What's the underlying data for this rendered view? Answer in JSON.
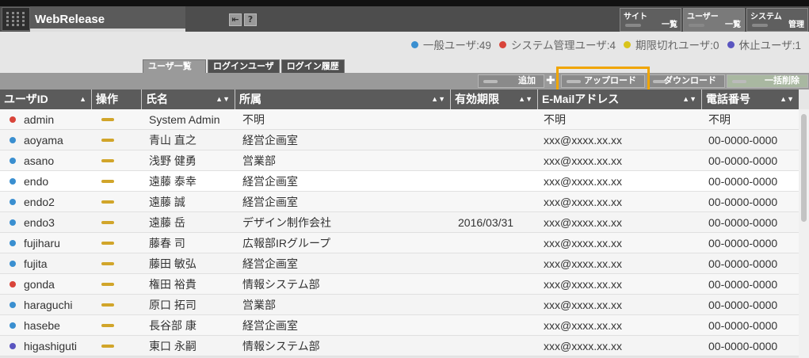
{
  "app": {
    "title": "WebRelease"
  },
  "header_icons": [
    "exit-icon",
    "help-icon"
  ],
  "help_glyph": "?",
  "nav": [
    {
      "line1": "サイト",
      "line2": "一覧"
    },
    {
      "line1": "ユーザー",
      "line2": "一覧"
    },
    {
      "line1": "システム",
      "line2": "管理"
    }
  ],
  "legend": [
    {
      "label": "一般ユーザ:49",
      "color": "#3a8fd0"
    },
    {
      "label": "システム管理ユーザ:4",
      "color": "#d9443a"
    },
    {
      "label": "期限切れユーザ:0",
      "color": "#d9c41a"
    },
    {
      "label": "休止ユーザ:1",
      "color": "#5a55c0"
    }
  ],
  "tabs": [
    "ユーザ一覧",
    "ログインユーザ",
    "ログイン履歴"
  ],
  "toolbar": {
    "add_label": "追加",
    "upload_label": "アップロード",
    "download_label": "ダウンロード",
    "bulk_delete_label": "一括削除"
  },
  "columns": [
    "ユーザID",
    "操作",
    "氏名",
    "所属",
    "有効期限",
    "E-Mailアドレス",
    "電話番号"
  ],
  "rows": [
    {
      "id": "admin",
      "name": "System Admin",
      "dept": "不明",
      "expiry": "",
      "email": "不明",
      "phone": "不明",
      "color": "#d9443a"
    },
    {
      "id": "aoyama",
      "name": "青山 直之",
      "dept": "経営企画室",
      "expiry": "",
      "email": "xxx@xxxx.xx.xx",
      "phone": "00-0000-0000",
      "color": "#3a8fd0"
    },
    {
      "id": "asano",
      "name": "浅野 健勇",
      "dept": "営業部",
      "expiry": "",
      "email": "xxx@xxxx.xx.xx",
      "phone": "00-0000-0000",
      "color": "#3a8fd0"
    },
    {
      "id": "endo",
      "name": "遠藤 泰幸",
      "dept": "経営企画室",
      "expiry": "",
      "email": "xxx@xxxx.xx.xx",
      "phone": "00-0000-0000",
      "color": "#3a8fd0"
    },
    {
      "id": "endo2",
      "name": "遠藤 誠",
      "dept": "経営企画室",
      "expiry": "",
      "email": "xxx@xxxx.xx.xx",
      "phone": "00-0000-0000",
      "color": "#3a8fd0"
    },
    {
      "id": "endo3",
      "name": "遠藤 岳",
      "dept": "デザイン制作会社",
      "expiry": "2016/03/31",
      "email": "xxx@xxxx.xx.xx",
      "phone": "00-0000-0000",
      "color": "#3a8fd0"
    },
    {
      "id": "fujiharu",
      "name": "藤春 司",
      "dept": "広報部IRグループ",
      "expiry": "",
      "email": "xxx@xxxx.xx.xx",
      "phone": "00-0000-0000",
      "color": "#3a8fd0"
    },
    {
      "id": "fujita",
      "name": "藤田 敏弘",
      "dept": "経営企画室",
      "expiry": "",
      "email": "xxx@xxxx.xx.xx",
      "phone": "00-0000-0000",
      "color": "#3a8fd0"
    },
    {
      "id": "gonda",
      "name": "権田 裕貴",
      "dept": "情報システム部",
      "expiry": "",
      "email": "xxx@xxxx.xx.xx",
      "phone": "00-0000-0000",
      "color": "#d9443a"
    },
    {
      "id": "haraguchi",
      "name": "原口 拓司",
      "dept": "営業部",
      "expiry": "",
      "email": "xxx@xxxx.xx.xx",
      "phone": "00-0000-0000",
      "color": "#3a8fd0"
    },
    {
      "id": "hasebe",
      "name": "長谷部 康",
      "dept": "経営企画室",
      "expiry": "",
      "email": "xxx@xxxx.xx.xx",
      "phone": "00-0000-0000",
      "color": "#3a8fd0"
    },
    {
      "id": "higashiguti",
      "name": "東口 永嗣",
      "dept": "情報システム部",
      "expiry": "",
      "email": "xxx@xxxx.xx.xx",
      "phone": "00-0000-0000",
      "color": "#5a55c0"
    }
  ]
}
